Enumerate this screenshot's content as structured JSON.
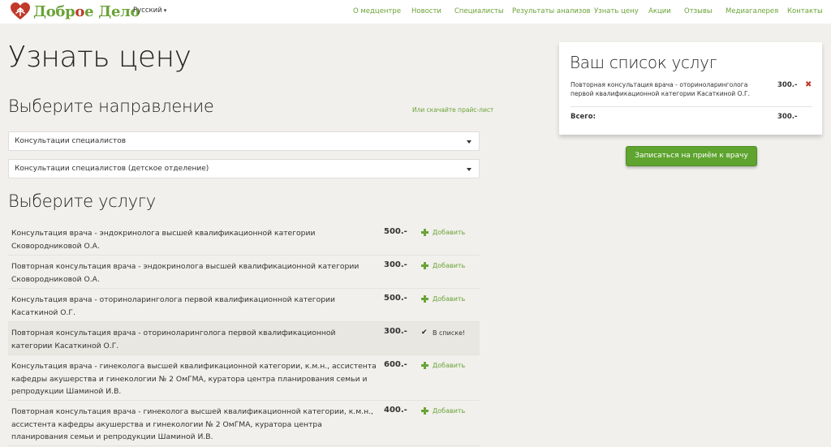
{
  "header": {
    "logo_part1": "Добр",
    "logo_part2": "о",
    "logo_part3": "е Дело",
    "language": "Русский",
    "nav": [
      "О медцентре",
      "Новости",
      "Специалисты",
      "Результаты анализов",
      "Узнать цену",
      "Акции",
      "Отзывы",
      "Медиагалерея",
      "Контакты"
    ]
  },
  "page_title": "Узнать цену",
  "direction": {
    "title": "Выберите направление",
    "price_link": "Или скачайте прайс-лист",
    "select1": "Консультации специалистов",
    "select2": "Консультации специалистов (детское отделение)"
  },
  "services": {
    "title": "Выберите услугу",
    "add_label": "Добавить",
    "in_list_label": "В списке!",
    "rows": [
      {
        "name": "Консультация врача - эндокринолога высшей квалификационной категории Сковородниковой О.А.",
        "price": "500.-",
        "action": "Добавить"
      },
      {
        "name": "Повторная консультация врача - эндокринолога высшей квалификационной категории Сковородниковой О.А.",
        "price": "300.-",
        "action": "Добавить"
      },
      {
        "name": "Консультация врача - оториноларинголога первой квалификационной категории Касаткиной О.Г.",
        "price": "500.-",
        "action": "Добавить"
      },
      {
        "name": "Повторная консультация врача - оториноларинголога первой квалификационной категории Касаткиной О.Г.",
        "price": "300.-",
        "action": "В списке!"
      },
      {
        "name": "Консультация врача - гинеколога высшей квалификационной категории, к.м.н., ассистента кафедры акушерства и гинекологии № 2 ОмГМА, куратора центра планирования семьи и репродукции Шаминой И.В.",
        "price": "600.-",
        "action": "Добавить"
      },
      {
        "name": "Повторная консультация врача - гинеколога высшей квалификационной категории, к.м.н., ассистента кафедры акушерства и гинекологии № 2 ОмГМА, куратора центра планирования семьи и репродукции Шаминой И.В.",
        "price": "400.-",
        "action": "Добавить"
      }
    ]
  },
  "cart": {
    "title": "Ваш список услуг",
    "item_name": "Повторная консультация врача - оториноларинголога первой квалификационной категории Касаткиной О.Г.",
    "item_price": "300.-",
    "total_label": "Всего:",
    "total_value": "300.-"
  },
  "book_button": "Записаться на приём к врачу",
  "colors": {
    "accent": "#6aa336",
    "button": "#5ea42f",
    "remove": "#c0392b",
    "background": "#f1f0ec"
  }
}
